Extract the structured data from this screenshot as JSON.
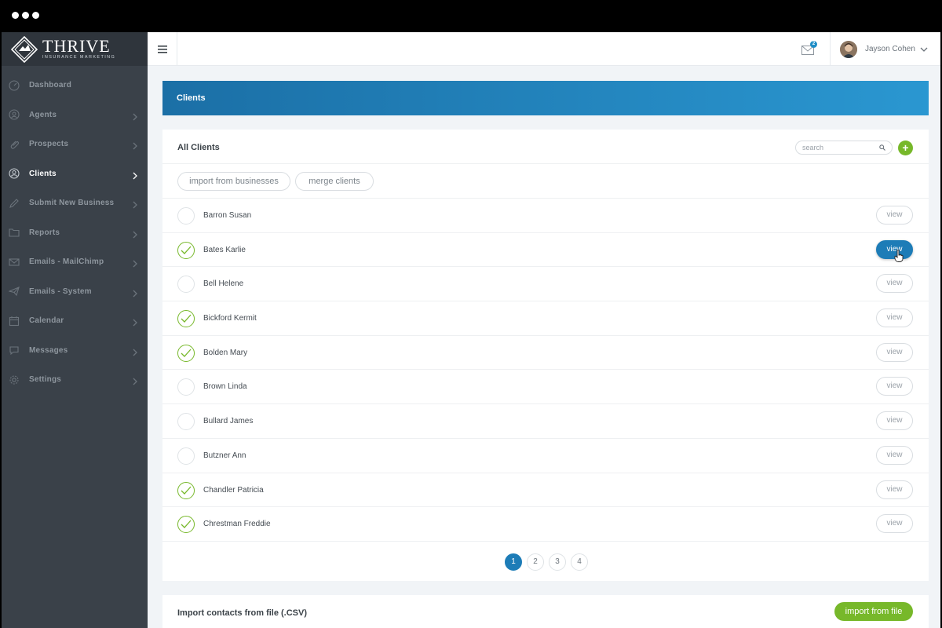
{
  "brand": {
    "name": "THRIVE",
    "tagline": "INSURANCE MARKETING"
  },
  "sidebar": {
    "items": [
      {
        "label": "Dashboard",
        "icon": "dashboard-icon",
        "has_chevron": false,
        "active": false
      },
      {
        "label": "Agents",
        "icon": "agents-icon",
        "has_chevron": true,
        "active": false
      },
      {
        "label": "Prospects",
        "icon": "paperclip-icon",
        "has_chevron": true,
        "active": false
      },
      {
        "label": "Clients",
        "icon": "clients-icon",
        "has_chevron": true,
        "active": true
      },
      {
        "label": "Submit New Business",
        "icon": "pencil-icon",
        "has_chevron": true,
        "active": false
      },
      {
        "label": "Reports",
        "icon": "folder-icon",
        "has_chevron": true,
        "active": false
      },
      {
        "label": "Emails - MailChimp",
        "icon": "envelope-icon",
        "has_chevron": true,
        "active": false
      },
      {
        "label": "Emails - System",
        "icon": "paper-plane-icon",
        "has_chevron": true,
        "active": false
      },
      {
        "label": "Calendar",
        "icon": "calendar-icon",
        "has_chevron": true,
        "active": false
      },
      {
        "label": "Messages",
        "icon": "chat-icon",
        "has_chevron": true,
        "active": false
      },
      {
        "label": "Settings",
        "icon": "gear-icon",
        "has_chevron": true,
        "active": false
      }
    ]
  },
  "topbar": {
    "mail_count": "2",
    "user_name": "Jayson Cohen"
  },
  "page": {
    "title": "Clients"
  },
  "clients_card": {
    "title": "All Clients",
    "search_placeholder": "search",
    "add_label": "+",
    "import_businesses_label": "import from businesses",
    "merge_clients_label": "merge clients",
    "view_label": "view",
    "rows": [
      {
        "name": "Barron Susan",
        "checked": false,
        "view_active": false
      },
      {
        "name": "Bates Karlie",
        "checked": true,
        "view_active": true
      },
      {
        "name": "Bell Helene",
        "checked": false,
        "view_active": false
      },
      {
        "name": "Bickford Kermit",
        "checked": true,
        "view_active": false
      },
      {
        "name": "Bolden Mary",
        "checked": true,
        "view_active": false
      },
      {
        "name": "Brown Linda",
        "checked": false,
        "view_active": false
      },
      {
        "name": "Bullard James",
        "checked": false,
        "view_active": false
      },
      {
        "name": "Butzner Ann",
        "checked": false,
        "view_active": false
      },
      {
        "name": "Chandler Patricia",
        "checked": true,
        "view_active": false
      },
      {
        "name": "Chrestman Freddie",
        "checked": true,
        "view_active": false
      }
    ],
    "pages": [
      "1",
      "2",
      "3",
      "4"
    ],
    "current_page": "1"
  },
  "import_card": {
    "title": "Import contacts from file (.CSV)",
    "button_label": "import from file"
  },
  "colors": {
    "accent_blue": "#1d7cb7",
    "accent_green": "#77b82a",
    "sidebar_bg": "#3a4149"
  }
}
